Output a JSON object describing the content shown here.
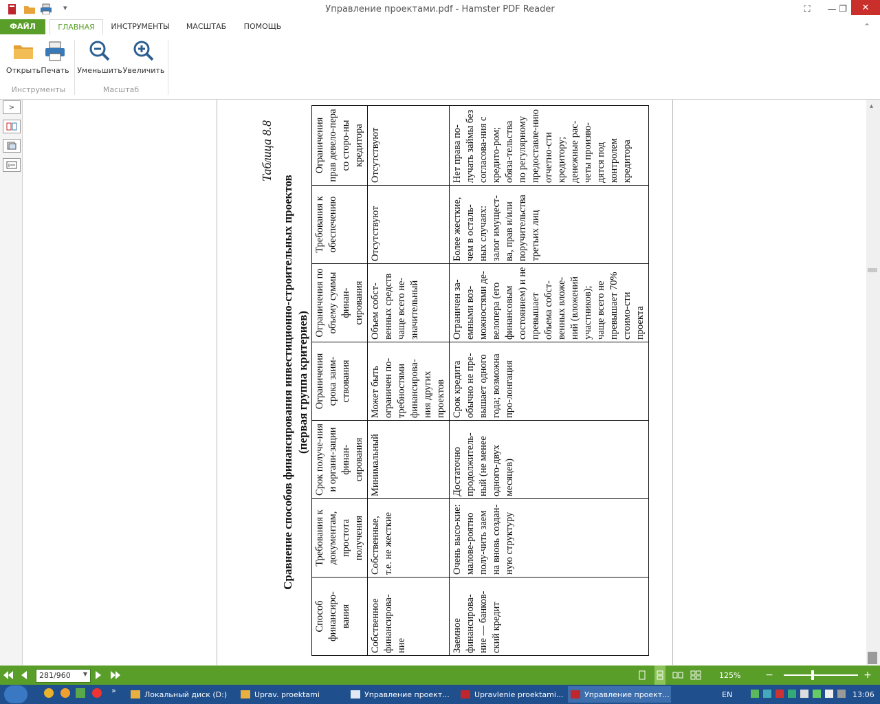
{
  "window": {
    "title": "Управление проектами.pdf - Hamster PDF Reader",
    "controls": {
      "minimize": "—",
      "restore": "❐",
      "close": "✕",
      "fullscreen": "⛶"
    }
  },
  "quick_access": {
    "dropdown": "▾"
  },
  "menu": {
    "tabs": [
      "ФАЙЛ",
      "ГЛАВНАЯ",
      "ИНСТРУМЕНТЫ",
      "МАСШТАБ",
      "ПОМОЩЬ"
    ],
    "active": "ГЛАВНАЯ",
    "collapse_icon": "⌃"
  },
  "ribbon": {
    "buttons": {
      "open": "Открыть",
      "print": "Печать",
      "zoom_out": "Уменьшить",
      "zoom_in": "Увеличить"
    },
    "groups": {
      "tools": "Инструменты",
      "scale": "Масштаб"
    },
    "accent": "#5a9e2a"
  },
  "left_panel": {
    "expand": ">"
  },
  "document": {
    "caption": "Таблица 8.8",
    "heading_line1": "Сравнение способов финансирования инвестиционно-строительных проектов",
    "heading_line2": "(первая группа критериев)",
    "table": {
      "headers": [
        "Способ финансиро-вания",
        "Требования к документам, простота получения",
        "Срок получе-ния и органи-зации финан-сирования",
        "Ограничения срока заим-ствования",
        "Ограничения по объему суммы финан-сирования",
        "Требования к обеспечению",
        "Ограничения прав девело-пера со сторо-ны кредитора"
      ],
      "rows": [
        [
          "Собственное финансирова-ние",
          "Собственные, т.е. не жесткие",
          "Минимальный",
          "Может быть ограничен по-требностями финансирова-ния других проектов",
          "Объем собст-венных средств чаще всего не-значительный",
          "Отсутствуют",
          "Отсутствуют"
        ],
        [
          "Заемное финансирова-ние — банков-ский кредит",
          "Очень высо-кие: малове-роятно полу-чить заем на вновь создан-ную структуру",
          "Достаточно продолжитель-ный (не менее одного-двух месяцев)",
          "Срок кредита обычно не пре-вышает одного года; возможна про-лонгация",
          "Ограничен за-емными воз-можностями де-велопера (его финансовым состоянием) и не превышает объема собст-венных вложе-ний (вложений участников); чаще всего не превышает 70% стоимо-сти проекта",
          "Более жесткие, чем в осталь-ных случаях: залог имущест-ва, прав и/или поручительства третьих лиц",
          "Нет права по-лучать займы без согласова-ния с кредито-ром; обяза-тельства по регулярному предоставле-нию отчетно-сти кредитору; денежные рас-четы произво-дятся под контролем кредитора"
        ]
      ]
    }
  },
  "statusbar": {
    "page": "281/960",
    "zoom": "125%",
    "minus": "−",
    "plus": "+"
  },
  "taskbar": {
    "tasks": [
      "Локальный диск (D:)",
      "Uprav. proektami",
      "Управление проект...",
      "Upravlenie proektami...",
      "Управление проект..."
    ],
    "lang": "EN",
    "time": "13:06",
    "more": "»"
  }
}
